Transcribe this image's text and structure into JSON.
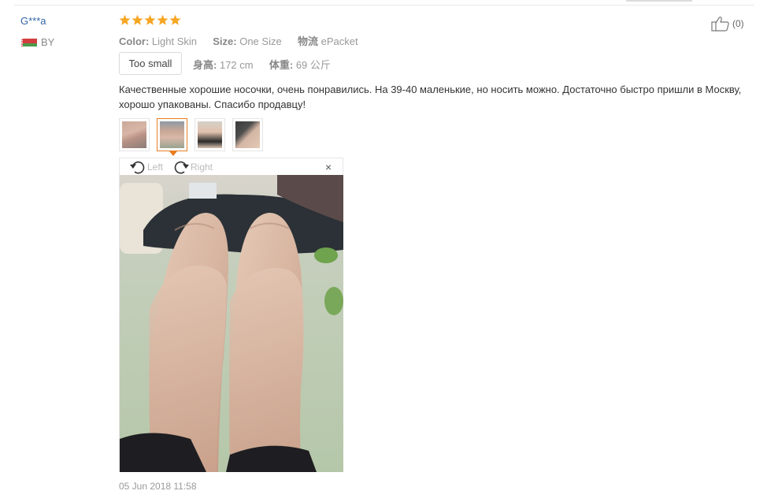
{
  "reviewer": {
    "name": "G***a",
    "country": "BY"
  },
  "helpful": {
    "count": "(0)"
  },
  "rating": {
    "stars": 5,
    "max": 5,
    "color": "#f5a623"
  },
  "attributes": {
    "color_label": "Color:",
    "color_value": "Light Skin",
    "size_label": "Size:",
    "size_value": "One Size",
    "shipping_label": "物流",
    "shipping_value": "ePacket"
  },
  "fit": {
    "label": "Too small"
  },
  "body": {
    "height_label": "身高:",
    "height_value": "172 cm",
    "weight_label": "体重:",
    "weight_value": "69 公斤"
  },
  "review": {
    "text": "Качественные хорошие носочки, очень понравились. На 39-40 маленькие, но носить можно. Достаточно быстро пришли в Москву, хорошо упакованы. Спасибо продавцу!"
  },
  "photos": {
    "count": 4,
    "active_index": 1
  },
  "viewer": {
    "rotate_left": "Left",
    "rotate_right": "Right",
    "close": "×"
  },
  "date": "05 Jun 2018 11:58",
  "colors": {
    "accent": "#e67e22",
    "link": "#3366a8"
  }
}
